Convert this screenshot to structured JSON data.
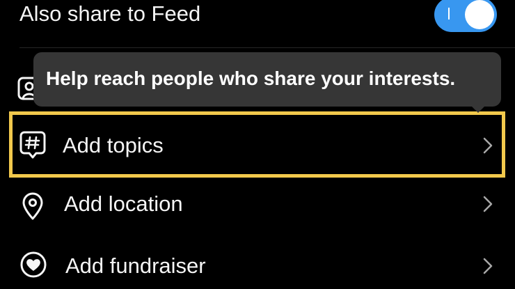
{
  "share_to_feed": {
    "label": "Also share to Feed",
    "enabled": true
  },
  "tooltip": {
    "text": "Help reach people who share your interests."
  },
  "menu": {
    "items": [
      {
        "label": "Add topics",
        "icon": "hashtag-bubble-icon",
        "highlighted": true
      },
      {
        "label": "Add location",
        "icon": "location-pin-icon"
      },
      {
        "label": "Add fundraiser",
        "icon": "fundraiser-heart-icon"
      }
    ]
  },
  "colors": {
    "background": "#000000",
    "toggle_on": "#3897f0",
    "tooltip_bg": "#363636",
    "highlight_border": "#f2c94c",
    "chevron": "#a8a8a8"
  }
}
